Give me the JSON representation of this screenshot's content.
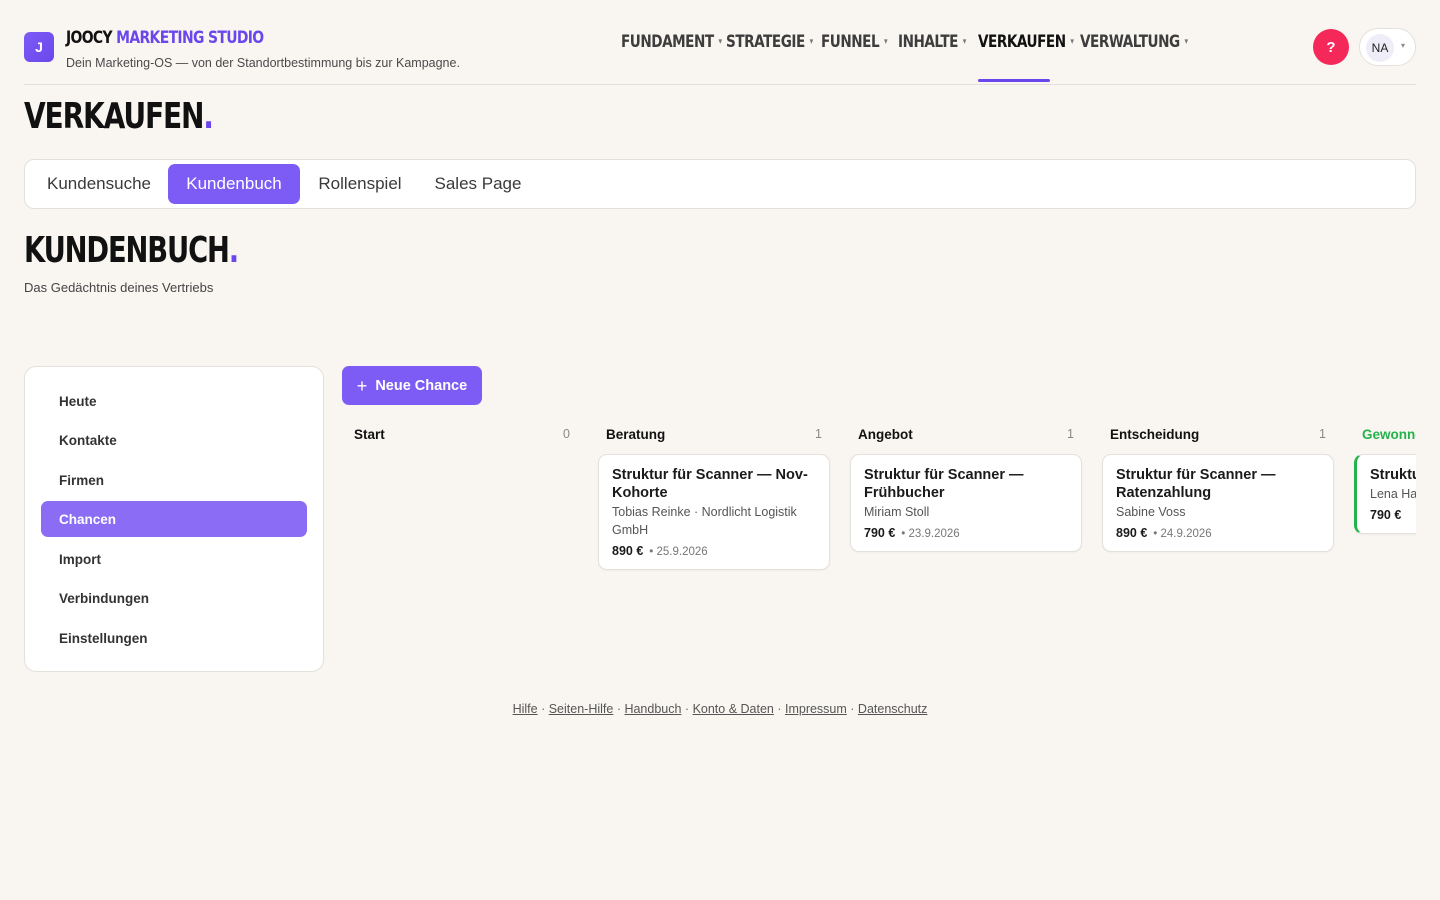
{
  "header": {
    "logo_letter": "J",
    "brand_part1": "JOOCY",
    "brand_part2": "MARKETING STUDIO",
    "tagline": "Dein Marketing-OS — von der Standortbestimmung bis zur Kampagne.",
    "nav": [
      {
        "label": "FUNDAMENT",
        "active": false
      },
      {
        "label": "STRATEGIE",
        "active": false
      },
      {
        "label": "FUNNEL",
        "active": false
      },
      {
        "label": "INHALTE",
        "active": false
      },
      {
        "label": "VERKAUFEN",
        "active": true
      },
      {
        "label": "VERWALTUNG",
        "active": false
      }
    ],
    "nav_caret": "▾",
    "help_label": "?",
    "user_initials": "NA",
    "user_caret": "▾"
  },
  "page": {
    "title": "VERKAUFEN",
    "title_dot": "."
  },
  "tabs": [
    {
      "label": "Kundensuche",
      "active": false
    },
    {
      "label": "Kundenbuch",
      "active": true
    },
    {
      "label": "Rollenspiel",
      "active": false
    },
    {
      "label": "Sales Page",
      "active": false
    }
  ],
  "section": {
    "title": "KUNDENBUCH",
    "title_dot": ".",
    "subtitle": "Das Gedächtnis deines Vertriebs"
  },
  "sidebar": {
    "items": [
      {
        "label": "Heute",
        "active": false
      },
      {
        "label": "Kontakte",
        "active": false
      },
      {
        "label": "Firmen",
        "active": false
      },
      {
        "label": "Chancen",
        "active": true
      },
      {
        "label": "Import",
        "active": false
      },
      {
        "label": "Verbindungen",
        "active": false
      },
      {
        "label": "Einstellungen",
        "active": false
      }
    ]
  },
  "board": {
    "new_button_label": "Neue Chance",
    "new_button_icon": "+",
    "columns": [
      {
        "name": "Start",
        "count": "0",
        "cards": []
      },
      {
        "name": "Beratung",
        "count": "1",
        "cards": [
          {
            "title": "Struktur für Scanner — Nov-Kohorte",
            "subtitle": "Tobias Reinke · Nordlicht Logistik GmbH",
            "price": "890 €",
            "date": "• 25.9.2026"
          }
        ]
      },
      {
        "name": "Angebot",
        "count": "1",
        "cards": [
          {
            "title": "Struktur für Scanner — Frühbucher",
            "subtitle": "Miriam Stoll",
            "price": "790 €",
            "date": "• 23.9.2026"
          }
        ]
      },
      {
        "name": "Entscheidung",
        "count": "1",
        "cards": [
          {
            "title": "Struktur für Scanner — Ratenzahlung",
            "subtitle": "Sabine Voss",
            "price": "890 €",
            "date": "• 24.9.2026"
          }
        ]
      },
      {
        "name": "Gewonnen",
        "count": "",
        "cards": [
          {
            "title": "Struktur für Scanner",
            "subtitle": "Lena Hartmann",
            "price": "790 €",
            "date": ""
          }
        ]
      }
    ]
  },
  "footer": {
    "links": [
      "Hilfe",
      "Seiten-Hilfe",
      "Handbuch",
      "Konto & Daten",
      "Impressum",
      "Datenschutz"
    ],
    "separator": " · "
  },
  "colors": {
    "accent": "#7c5cf5",
    "accent_dark": "#6a47ec",
    "help_red": "#f5285a",
    "won_green": "#25b14c",
    "background": "#f9f6f2"
  }
}
